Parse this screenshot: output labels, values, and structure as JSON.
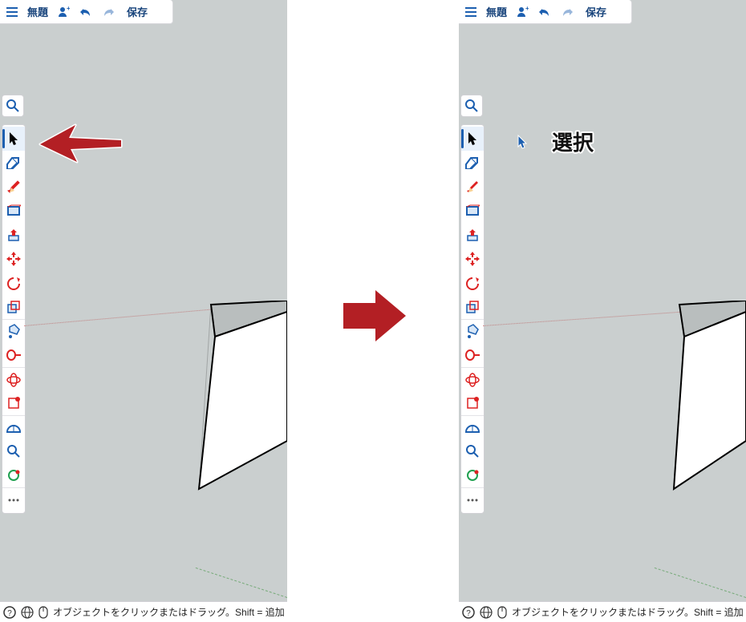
{
  "colors": {
    "accent": "#b31f24",
    "blue": "#1c5fb0",
    "red": "#d22"
  },
  "app": {
    "title": "無題",
    "save_label": "保存",
    "status_text": "オブジェクトをクリックまたはドラッグ。Shift = 追加"
  },
  "annotation": {
    "tooltip": "選択"
  },
  "tools": {
    "search": "検索",
    "items": [
      {
        "id": "select",
        "label": "選択"
      },
      {
        "id": "eraser",
        "label": "消しゴム"
      },
      {
        "id": "pencil",
        "label": "線"
      },
      {
        "id": "rect",
        "label": "長方形"
      },
      {
        "id": "pushpull",
        "label": "プッシュ/プル"
      },
      {
        "id": "move",
        "label": "移動"
      },
      {
        "id": "rotate",
        "label": "回転"
      },
      {
        "id": "scale",
        "label": "尺度"
      },
      {
        "id": "paint",
        "label": "ペイント"
      },
      {
        "id": "tape",
        "label": "メジャー"
      },
      {
        "id": "orbit",
        "label": "オービット"
      },
      {
        "id": "pan",
        "label": "パン"
      },
      {
        "id": "protractor",
        "label": "分度器"
      },
      {
        "id": "zoom",
        "label": "ズーム"
      },
      {
        "id": "styles",
        "label": "スタイル"
      },
      {
        "id": "more",
        "label": "その他"
      }
    ]
  }
}
